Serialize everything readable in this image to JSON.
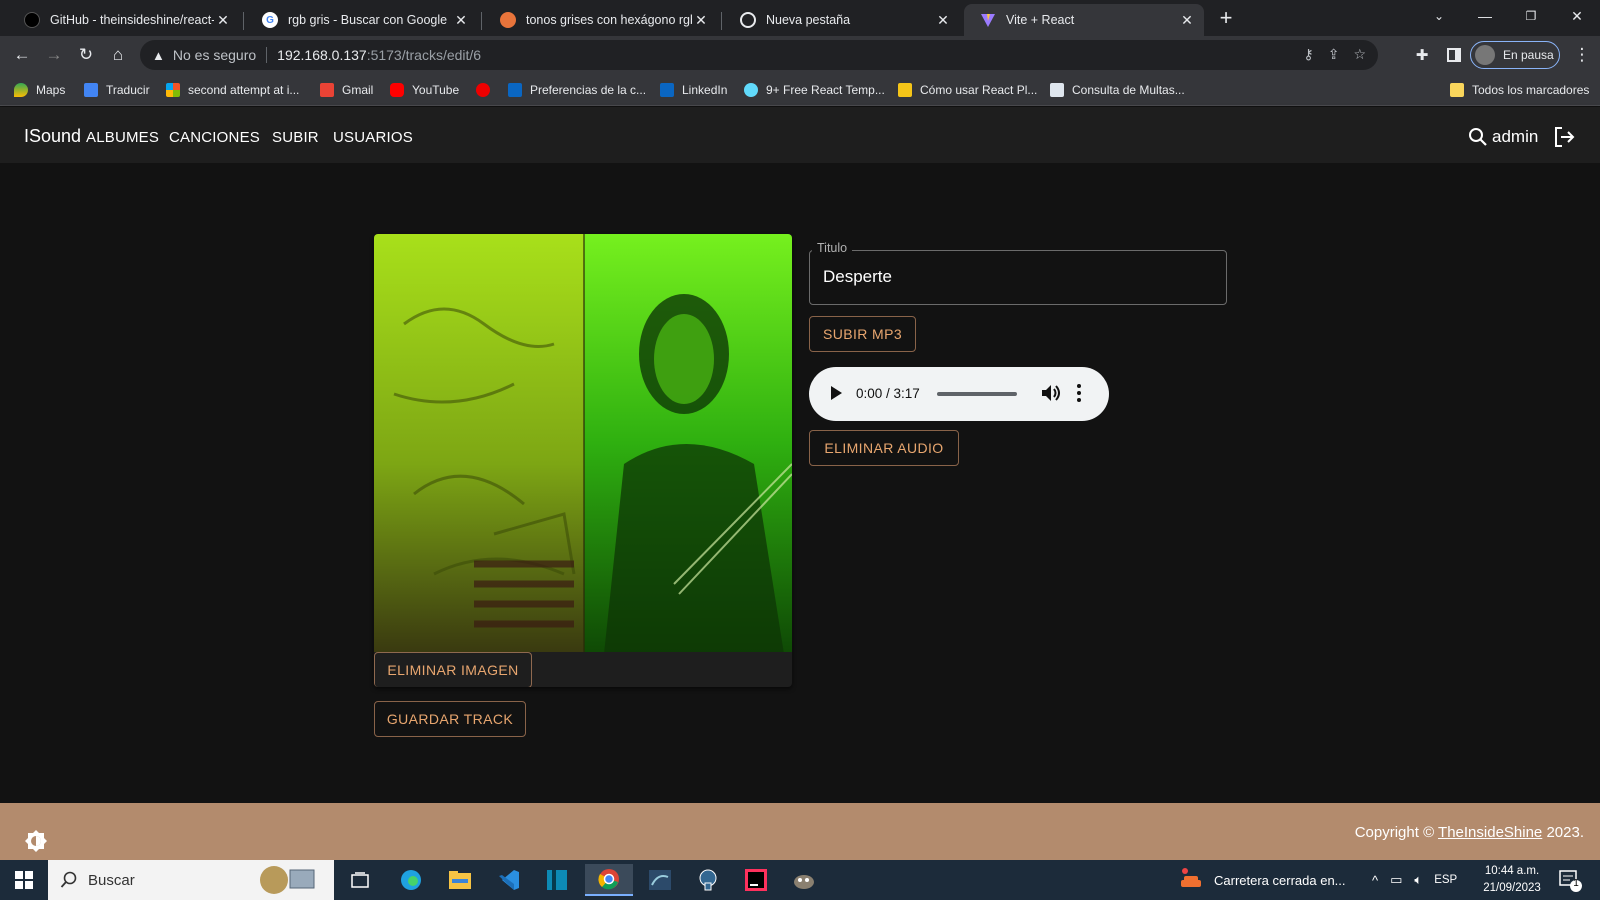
{
  "browser": {
    "tabs": [
      {
        "title": "GitHub - theinsideshine/react-ins",
        "active": false
      },
      {
        "title": "rgb gris - Buscar con Google",
        "active": false
      },
      {
        "title": "tonos grises con hexágono rgb p",
        "active": false
      },
      {
        "title": "Nueva pestaña",
        "active": false
      },
      {
        "title": "Vite + React",
        "active": true
      }
    ],
    "new_tab_icon": "plus-icon",
    "address": {
      "security_label": "No es seguro",
      "host": "192.168.0.137",
      "path": ":5173/tracks/edit/6"
    },
    "profile_label": "En pausa",
    "bookmarks": [
      "Maps",
      "Traducir",
      "second attempt at i...",
      "Gmail",
      "YouTube",
      "",
      "Preferencias de la c...",
      "LinkedIn",
      "9+ Free React Temp...",
      "Cómo usar React Pl...",
      "Consulta de Multas..."
    ],
    "all_bookmarks_label": "Todos los marcadores"
  },
  "app": {
    "brand": "ISound",
    "nav": [
      "ALBUMES",
      "CANCIONES",
      "SUBIR",
      "USUARIOS"
    ],
    "user": "admin",
    "icons": {
      "search": "search-icon",
      "logout": "logout-icon",
      "theme": "brightness-icon"
    }
  },
  "form": {
    "title_label": "Titulo",
    "title_value": "Desperte",
    "upload_mp3_label": "SUBIR MP3",
    "audio_time": "0:00 / 3:17",
    "audio_progress": 0,
    "delete_audio_label": "ELIMINAR AUDIO",
    "delete_image_label": "ELIMINAR IMAGEN",
    "save_track_label": "GUARDAR TRACK"
  },
  "footer": {
    "copyright_prefix": "Copyright ©",
    "copyright_link": "TheInsideShine",
    "copyright_year": "2023."
  },
  "taskbar": {
    "search_placeholder": "Buscar",
    "news": "Carretera cerrada en...",
    "language": "ESP",
    "time": "10:44 a.m.",
    "date": "21/09/2023",
    "notification_count": "1"
  },
  "colors": {
    "accent_outline": "#e8a66f",
    "footer_bg": "#b38b6d",
    "page_bg": "#121212"
  }
}
